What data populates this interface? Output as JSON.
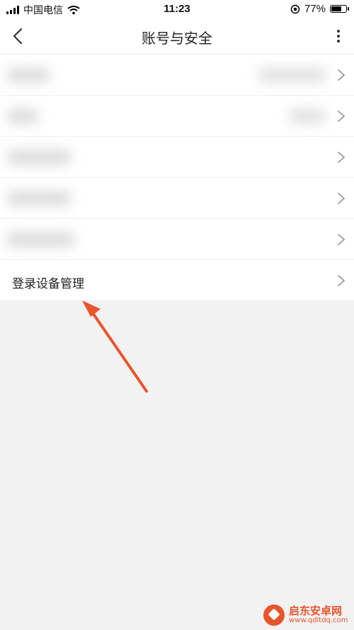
{
  "status_bar": {
    "carrier": "中国电信",
    "time": "11:23",
    "battery_percent_label": "77%",
    "battery_level": 0.77
  },
  "nav": {
    "title": "账号与安全",
    "back_icon": "chevron-left-icon",
    "more_icon": "more-vertical-icon"
  },
  "list": {
    "items": [
      {
        "label": "登录设备管理"
      }
    ]
  },
  "annotation": {
    "color": "#e8552d"
  },
  "watermark": {
    "title": "启东安卓网",
    "url": "www.qdltdq.com"
  }
}
